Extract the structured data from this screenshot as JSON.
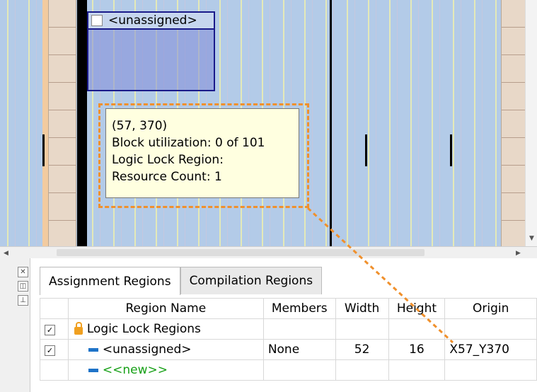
{
  "floorplan": {
    "region_label": "<unassigned>",
    "tooltip": {
      "line1": "(57, 370)",
      "line2": "Block utilization: 0 of 101",
      "line3": "Logic Lock Region:",
      "line4": "Resource Count: 1"
    }
  },
  "side_icons": [
    "close-icon",
    "restore-icon",
    "pin-icon"
  ],
  "tabs": [
    "Assignment Regions",
    "Compilation Regions"
  ],
  "table": {
    "headers": [
      "Region Name",
      "Members",
      "Width",
      "Height",
      "Origin"
    ],
    "rows": [
      {
        "checked": "✓",
        "name": "Logic Lock Regions",
        "members": "",
        "width": "",
        "height": "",
        "origin": ""
      },
      {
        "checked": "✓",
        "name": "<unassigned>",
        "members": "None",
        "width": "52",
        "height": "16",
        "origin": "X57_Y370"
      },
      {
        "checked": "",
        "name": "<<new>>",
        "members": "",
        "width": "",
        "height": "",
        "origin": ""
      }
    ]
  },
  "colors": {
    "accent_orange": "#f0902c",
    "region_blue": "#1a1a8a",
    "new_green": "#16a016"
  }
}
